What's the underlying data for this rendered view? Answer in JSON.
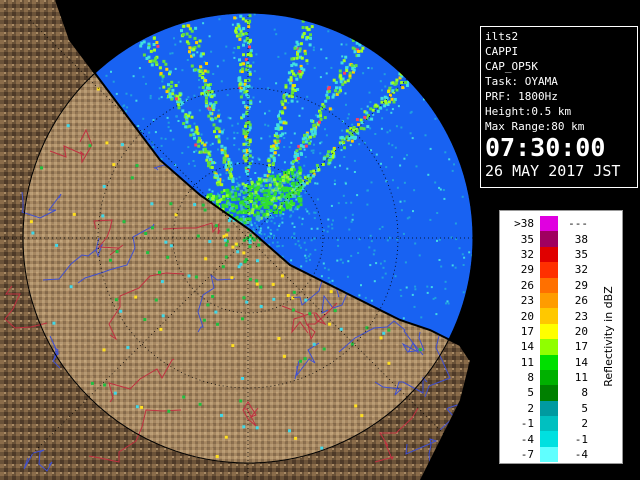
{
  "info_panel": {
    "lines": [
      "ilts2",
      "CAPPI",
      "CAP_OP5K",
      "Task: OYAMA",
      "PRF: 1800Hz",
      "Height:0.5 km",
      "Max Range:80 km"
    ],
    "time": "07:30:00",
    "date": "26 MAY 2017 JST"
  },
  "legend": {
    "title": "Reflectivity in dBZ",
    "rows": [
      {
        "min": ">38",
        "max": "---",
        "color": "#e000e0"
      },
      {
        "min": "35",
        "max": "38",
        "color": "#a00060"
      },
      {
        "min": "32",
        "max": "35",
        "color": "#e00000"
      },
      {
        "min": "29",
        "max": "32",
        "color": "#ff3000"
      },
      {
        "min": "26",
        "max": "29",
        "color": "#ff7000"
      },
      {
        "min": "23",
        "max": "26",
        "color": "#ff9c00"
      },
      {
        "min": "20",
        "max": "23",
        "color": "#ffc800"
      },
      {
        "min": "17",
        "max": "20",
        "color": "#ffff00"
      },
      {
        "min": "14",
        "max": "17",
        "color": "#90ff00"
      },
      {
        "min": "11",
        "max": "14",
        "color": "#00e000"
      },
      {
        "min": "8",
        "max": "11",
        "color": "#00b000"
      },
      {
        "min": "5",
        "max": "8",
        "color": "#008000"
      },
      {
        "min": "2",
        "max": "5",
        "color": "#009aa0"
      },
      {
        "min": "-1",
        "max": "2",
        "color": "#00c0c0"
      },
      {
        "min": "-4",
        "max": "-1",
        "color": "#00e0e0"
      },
      {
        "min": "-7",
        "max": "-4",
        "color": "#60ffff"
      }
    ]
  },
  "map": {
    "colors": {
      "sea_background": "#000000",
      "radar_coverage": "#1560f0",
      "land_dark": "#5a4430",
      "land_light": "#b89a70",
      "rivers": "#4050d0",
      "boundaries": "#c03040",
      "range_rings": "#000000"
    }
  }
}
